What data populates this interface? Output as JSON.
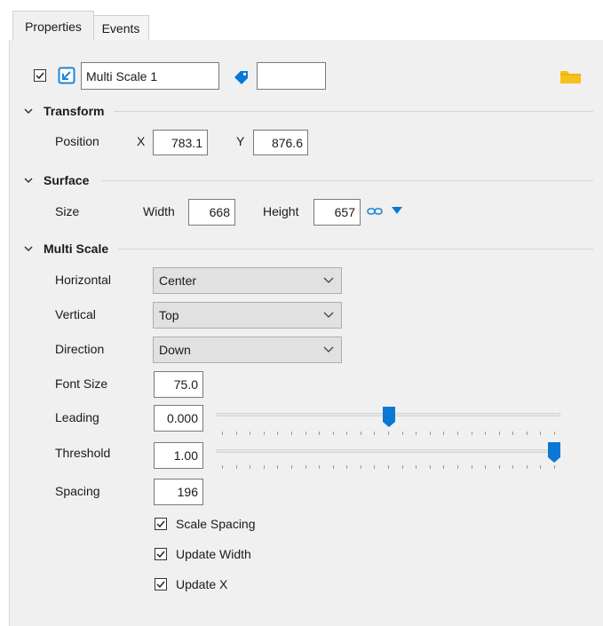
{
  "tabs": [
    {
      "label": "Properties",
      "active": true
    },
    {
      "label": "Events",
      "active": false
    }
  ],
  "header": {
    "enabled_checked": true,
    "name_value": "Multi Scale 1",
    "tag_value": ""
  },
  "sections": {
    "transform": {
      "title": "Transform",
      "position_label": "Position",
      "x_label": "X",
      "x_value": "783.1",
      "y_label": "Y",
      "y_value": "876.6"
    },
    "surface": {
      "title": "Surface",
      "size_label": "Size",
      "width_label": "Width",
      "width_value": "668",
      "height_label": "Height",
      "height_value": "657"
    },
    "multi_scale": {
      "title": "Multi Scale",
      "horizontal_label": "Horizontal",
      "horizontal_value": "Center",
      "vertical_label": "Vertical",
      "vertical_value": "Top",
      "direction_label": "Direction",
      "direction_value": "Down",
      "font_size_label": "Font Size",
      "font_size_value": "75.0",
      "leading_label": "Leading",
      "leading_value": "0.000",
      "leading_slider_fraction": 0.5,
      "threshold_label": "Threshold",
      "threshold_value": "1.00",
      "threshold_slider_fraction": 1.0,
      "spacing_label": "Spacing",
      "spacing_value": "196",
      "checks": [
        {
          "label": "Scale Spacing",
          "checked": true
        },
        {
          "label": "Update Width",
          "checked": true
        },
        {
          "label": "Update X",
          "checked": true
        }
      ]
    }
  },
  "colors": {
    "accent": "#0078d7",
    "folder": "#f7c01c"
  }
}
